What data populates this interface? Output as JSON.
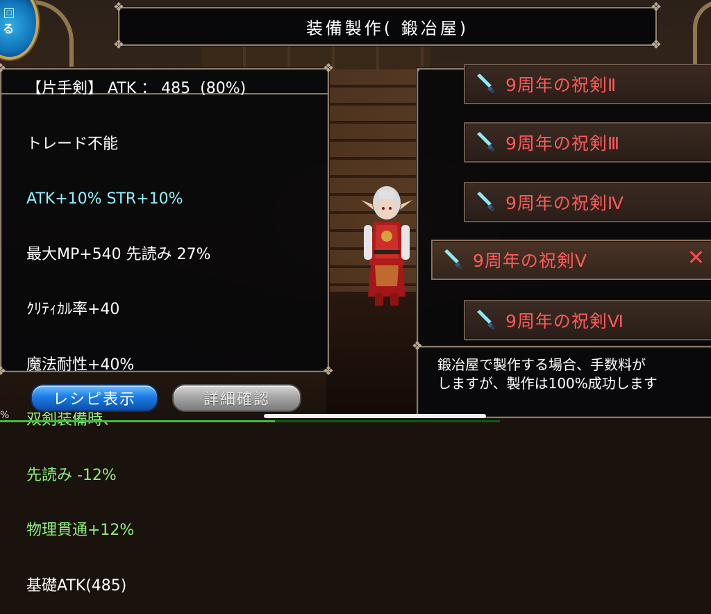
{
  "header": {
    "title": "装備製作( 鍛冶屋)",
    "badge_label": "る"
  },
  "details": {
    "lines": [
      {
        "text": "【片手剣】 ATK ： 485  (80%)",
        "color": "white"
      },
      {
        "text": "トレード不能",
        "color": "white"
      },
      {
        "text": "ATK+10% STR+10%",
        "color": "cyan"
      },
      {
        "text": "最大MP+540 先読み 27%",
        "color": "white"
      },
      {
        "text": "ｸﾘﾃｨｶﾙ率+40",
        "color": "white"
      },
      {
        "text": "魔法耐性+40%",
        "color": "white"
      },
      {
        "text": "双剣装備時、",
        "color": "green"
      },
      {
        "text": "先読み -12%",
        "color": "green"
      },
      {
        "text": "物理貫通+12%",
        "color": "green"
      },
      {
        "text": "基礎ATK(485)",
        "color": "white"
      }
    ]
  },
  "recipe_list": {
    "items": [
      {
        "label": "9周年の祝剣Ⅱ",
        "selected": false
      },
      {
        "label": "9周年の祝剣Ⅲ",
        "selected": false
      },
      {
        "label": "9周年の祝剣Ⅳ",
        "selected": false
      },
      {
        "label": "9周年の祝剣Ⅴ",
        "selected": true
      },
      {
        "label": "9周年の祝剣Ⅵ",
        "selected": false
      }
    ],
    "close_symbol": "✕"
  },
  "info": {
    "line1": "鍛冶屋で製作する場合、手数料が",
    "line2": "しますが、製作は100%成功します"
  },
  "buttons": {
    "recipe_label": "レシピ表示",
    "detail_label": "詳細確認"
  },
  "footer": {
    "pct_label": "%"
  },
  "colors": {
    "item_text": "#ff5a5a",
    "cyan_text": "#8ff3ff",
    "green_text": "#8df07a",
    "frame": "#8a7c6a"
  }
}
